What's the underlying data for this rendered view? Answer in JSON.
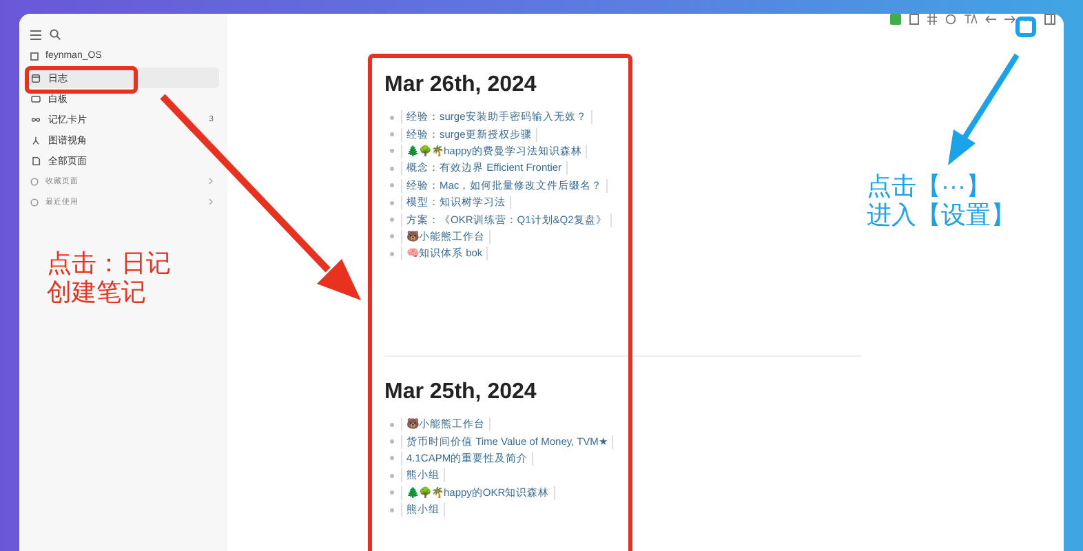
{
  "sidebar": {
    "workspace": "feynman_OS",
    "items": [
      {
        "label": "日志",
        "selected": true
      },
      {
        "label": "白板",
        "selected": false
      },
      {
        "label": "记忆卡片",
        "selected": false,
        "count": "3"
      },
      {
        "label": "图谱视角",
        "selected": false
      },
      {
        "label": "全部页面",
        "selected": false
      }
    ],
    "sections": [
      "收藏页面",
      "最近使用"
    ]
  },
  "journals": [
    {
      "date": "Mar 26th, 2024",
      "entries": [
        "经验：surge安装助手密码输入无效？",
        "经验：surge更新授权步骤",
        "🌲🌳🌴happy的费曼学习法知识森林",
        "概念：有效边界 Efficient Frontier",
        "经验：Mac，如何批量修改文件后缀名？",
        "模型：知识树学习法",
        "方案：《OKR训练营：Q1计划&Q2复盘》",
        "🐻小能熊工作台",
        "🧠知识体系 bok"
      ]
    },
    {
      "date": "Mar 25th, 2024",
      "entries": [
        "🐻小能熊工作台",
        "货币时间价值 Time Value of Money, TVM★",
        "4.1CAPM的重要性及简介",
        "熊小组",
        "🌲🌳🌴happy的OKR知识森林",
        "熊小组"
      ]
    }
  ],
  "annotations": {
    "left_note": [
      "点击：日记",
      "创建笔记"
    ],
    "right_note": [
      "点击【···】",
      "进入【设置】"
    ]
  }
}
